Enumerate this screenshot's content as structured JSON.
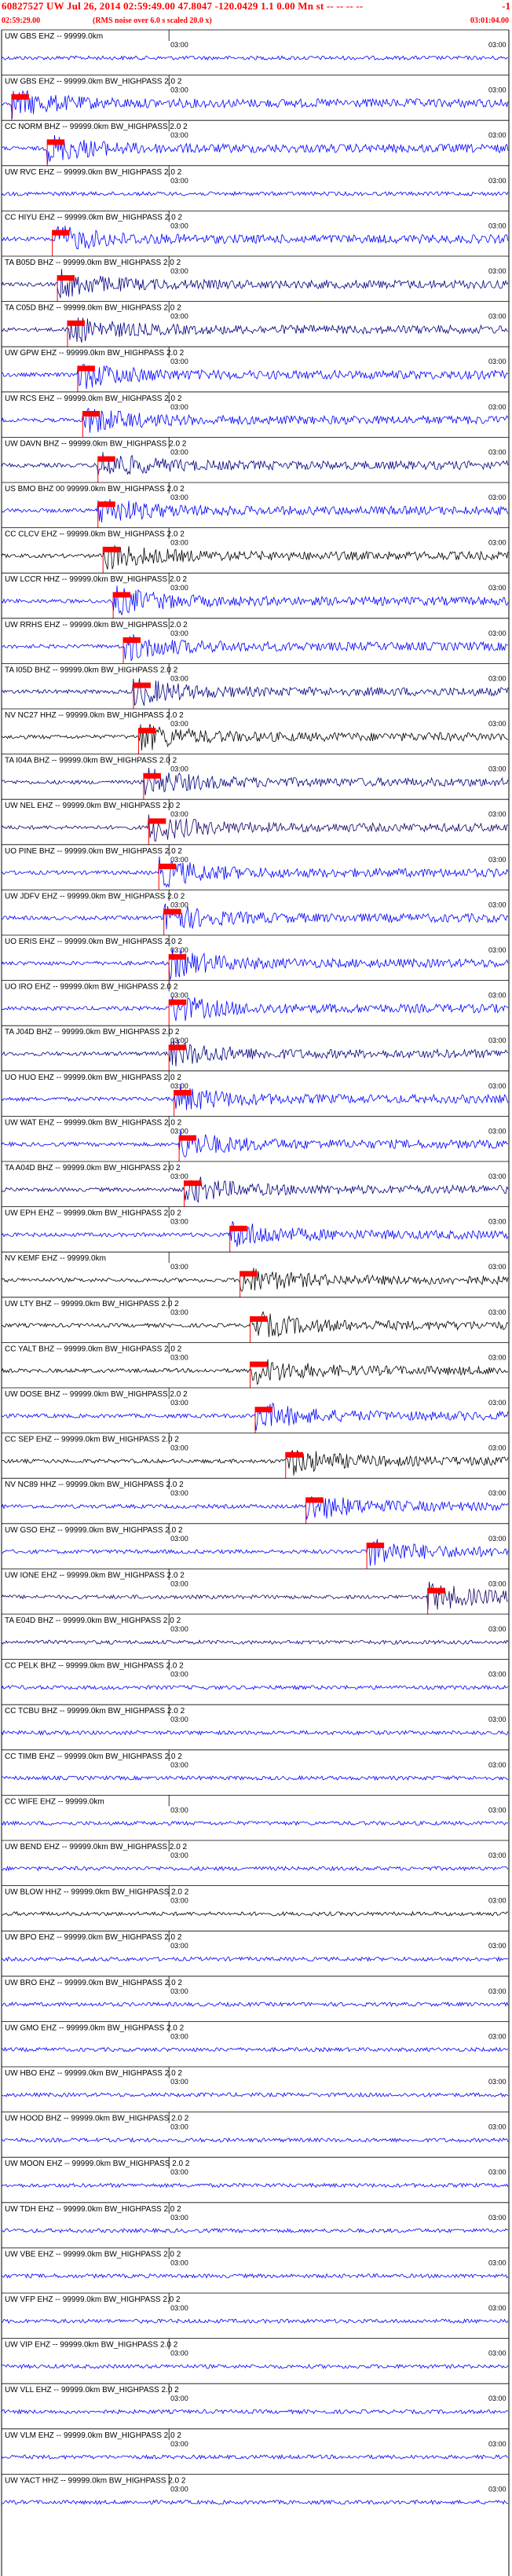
{
  "header": {
    "title": "60827527 UW Jul 26, 2014 02:59:49.00   47.8047 -120.0429  1.1 0.00 Mn st -- -- -- --",
    "right_mark": "-1",
    "start_time": "02:59:29.00",
    "end_time": "03:01:04.00",
    "note": "(RMS noise over 6.0 s scaled 20.0 x)"
  },
  "colors": {
    "pick": "#ff0000",
    "blue": "#0000ff",
    "dark_blue": "#000080",
    "navy": "#1a0066",
    "black": "#000000",
    "red": "#ff0000"
  },
  "chart_data": {
    "type": "line",
    "time_start": "02:59:29.00",
    "time_end": "03:01:04.00",
    "tick_label": "03:00",
    "traces": [
      {
        "label": "UW GBS EHZ -- 99999.0km",
        "color": "blue",
        "arrival": null
      },
      {
        "label": "UW GBS EHZ -- 99999.0km BW_HIGHPASS  2.0  2",
        "color": "blue",
        "arrival": 0.02
      },
      {
        "label": "CC NORM BHZ -- 99999.0km BW_HIGHPASS  2.0  2",
        "color": "blue",
        "arrival": 0.09
      },
      {
        "label": "UW RVC EHZ -- 99999.0km BW_HIGHPASS  2.0  2",
        "color": "blue",
        "arrival": null
      },
      {
        "label": "CC HIYU EHZ -- 99999.0km BW_HIGHPASS  2.0  2",
        "color": "blue",
        "arrival": 0.1
      },
      {
        "label": "TA B05D BHZ -- 99999.0km BW_HIGHPASS  2.0  2",
        "color": "dark_blue",
        "arrival": 0.11
      },
      {
        "label": "TA C05D BHZ -- 99999.0km BW_HIGHPASS  2.0  2",
        "color": "dark_blue",
        "arrival": 0.13
      },
      {
        "label": "UW GPW EHZ -- 99999.0km BW_HIGHPASS  2.0  2",
        "color": "blue",
        "arrival": 0.15
      },
      {
        "label": "UW RCS EHZ -- 99999.0km BW_HIGHPASS  2.0  2",
        "color": "blue",
        "arrival": 0.16
      },
      {
        "label": "UW DAVN BHZ -- 99999.0km BW_HIGHPASS  2.0  2",
        "color": "dark_blue",
        "arrival": 0.19
      },
      {
        "label": "US BMO BHZ 00 99999.0km BW_HIGHPASS  2.0  2",
        "color": "blue",
        "arrival": 0.19
      },
      {
        "label": "CC CLCV EHZ -- 99999.0km BW_HIGHPASS  2.0  2",
        "color": "black",
        "arrival": 0.2
      },
      {
        "label": "UW LCCR HHZ -- 99999.0km BW_HIGHPASS  2.0  2",
        "color": "blue",
        "arrival": 0.22
      },
      {
        "label": "UW RRHS EHZ -- 99999.0km BW_HIGHPASS  2.0  2",
        "color": "blue",
        "arrival": 0.24
      },
      {
        "label": "TA I05D BHZ -- 99999.0km BW_HIGHPASS  2.0  2",
        "color": "dark_blue",
        "arrival": 0.26
      },
      {
        "label": "NV NC27 HHZ -- 99999.0km BW_HIGHPASS  2.0  2",
        "color": "black",
        "arrival": 0.27
      },
      {
        "label": "TA I04A BHZ -- 99999.0km BW_HIGHPASS  2.0  2",
        "color": "dark_blue",
        "arrival": 0.28
      },
      {
        "label": "UW NEL EHZ -- 99999.0km BW_HIGHPASS  2.0  2",
        "color": "navy",
        "arrival": 0.29
      },
      {
        "label": "UO PINE BHZ -- 99999.0km BW_HIGHPASS  2.0  2",
        "color": "blue",
        "arrival": 0.31
      },
      {
        "label": "UW JDFV EHZ -- 99999.0km BW_HIGHPASS  2.0  2",
        "color": "blue",
        "arrival": 0.32
      },
      {
        "label": "UO ERIS EHZ -- 99999.0km BW_HIGHPASS  2.0  2",
        "color": "blue",
        "arrival": 0.33
      },
      {
        "label": "UO IRO EHZ -- 99999.0km BW_HIGHPASS  2.0  2",
        "color": "blue",
        "arrival": 0.33
      },
      {
        "label": "TA J04D BHZ -- 99999.0km BW_HIGHPASS  2.0  2",
        "color": "dark_blue",
        "arrival": 0.33
      },
      {
        "label": "UO HUO EHZ -- 99999.0km BW_HIGHPASS  2.0  2",
        "color": "blue",
        "arrival": 0.34
      },
      {
        "label": "UW WAT EHZ -- 99999.0km BW_HIGHPASS  2.0  2",
        "color": "blue",
        "arrival": 0.35
      },
      {
        "label": "TA A04D BHZ -- 99999.0km BW_HIGHPASS  2.0  2",
        "color": "dark_blue",
        "arrival": 0.36
      },
      {
        "label": "UW EPH EHZ -- 99999.0km BW_HIGHPASS  2.0  2",
        "color": "blue",
        "arrival": 0.45
      },
      {
        "label": "NV KEMF EHZ -- 99999.0km",
        "color": "black",
        "arrival": 0.47
      },
      {
        "label": "UW LTY BHZ -- 99999.0km BW_HIGHPASS  2.0  2",
        "color": "black",
        "arrival": 0.49
      },
      {
        "label": "CC YALT BHZ -- 99999.0km BW_HIGHPASS  2.0  2",
        "color": "black",
        "arrival": 0.49
      },
      {
        "label": "UW DOSE BHZ -- 99999.0km BW_HIGHPASS  2.0  2",
        "color": "blue",
        "arrival": 0.5
      },
      {
        "label": "CC SEP EHZ -- 99999.0km BW_HIGHPASS  2.0  2",
        "color": "black",
        "arrival": 0.56
      },
      {
        "label": "NV NC89 HHZ -- 99999.0km BW_HIGHPASS  2.0  2",
        "color": "blue",
        "arrival": 0.6
      },
      {
        "label": "UW GSO EHZ -- 99999.0km BW_HIGHPASS  2.0  2",
        "color": "blue",
        "arrival": 0.72
      },
      {
        "label": "UW IONE EHZ -- 99999.0km BW_HIGHPASS  2.0  2",
        "color": "navy",
        "arrival": 0.84
      },
      {
        "label": "TA E04D BHZ -- 99999.0km BW_HIGHPASS  2.0  2",
        "color": "dark_blue",
        "arrival": null
      },
      {
        "label": "CC PELK BHZ -- 99999.0km BW_HIGHPASS  2.0  2",
        "color": "blue",
        "arrival": null
      },
      {
        "label": "CC TCBU BHZ -- 99999.0km BW_HIGHPASS  2.0  2",
        "color": "blue",
        "arrival": null
      },
      {
        "label": "CC TIMB EHZ -- 99999.0km BW_HIGHPASS  2.0  2",
        "color": "blue",
        "arrival": null
      },
      {
        "label": "CC WIFE EHZ -- 99999.0km",
        "color": "blue",
        "arrival": null
      },
      {
        "label": "UW BEND EHZ -- 99999.0km BW_HIGHPASS  2.0  2",
        "color": "blue",
        "arrival": null
      },
      {
        "label": "UW BLOW HHZ -- 99999.0km BW_HIGHPASS  2.0  2",
        "color": "black",
        "arrival": null
      },
      {
        "label": "UW BPO EHZ -- 99999.0km BW_HIGHPASS  2.0  2",
        "color": "blue",
        "arrival": null
      },
      {
        "label": "UW BRO EHZ -- 99999.0km BW_HIGHPASS  2.0  2",
        "color": "blue",
        "arrival": null
      },
      {
        "label": "UW GMO EHZ -- 99999.0km BW_HIGHPASS  2.0  2",
        "color": "blue",
        "arrival": null
      },
      {
        "label": "UW HBO EHZ -- 99999.0km BW_HIGHPASS  2.0  2",
        "color": "blue",
        "arrival": null
      },
      {
        "label": "UW HOOD BHZ -- 99999.0km BW_HIGHPASS  2.0  2",
        "color": "blue",
        "arrival": null
      },
      {
        "label": "UW MOON EHZ -- 99999.0km BW_HIGHPASS  2.0  2",
        "color": "blue",
        "arrival": null
      },
      {
        "label": "UW TDH EHZ -- 99999.0km BW_HIGHPASS  2.0  2",
        "color": "blue",
        "arrival": null
      },
      {
        "label": "UW VBE EHZ -- 99999.0km BW_HIGHPASS  2.0  2",
        "color": "blue",
        "arrival": null
      },
      {
        "label": "UW VFP EHZ -- 99999.0km BW_HIGHPASS  2.0  2",
        "color": "blue",
        "arrival": null
      },
      {
        "label": "UW VIP EHZ -- 99999.0km BW_HIGHPASS  2.0  2",
        "color": "blue",
        "arrival": null
      },
      {
        "label": "UW VLL EHZ -- 99999.0km BW_HIGHPASS  2.0  2",
        "color": "blue",
        "arrival": null
      },
      {
        "label": "UW VLM EHZ -- 99999.0km BW_HIGHPASS  2.0  2",
        "color": "blue",
        "arrival": null
      },
      {
        "label": "UW YACT HHZ -- 99999.0km BW_HIGHPASS  2.0  2",
        "color": "blue",
        "arrival": null
      }
    ]
  }
}
